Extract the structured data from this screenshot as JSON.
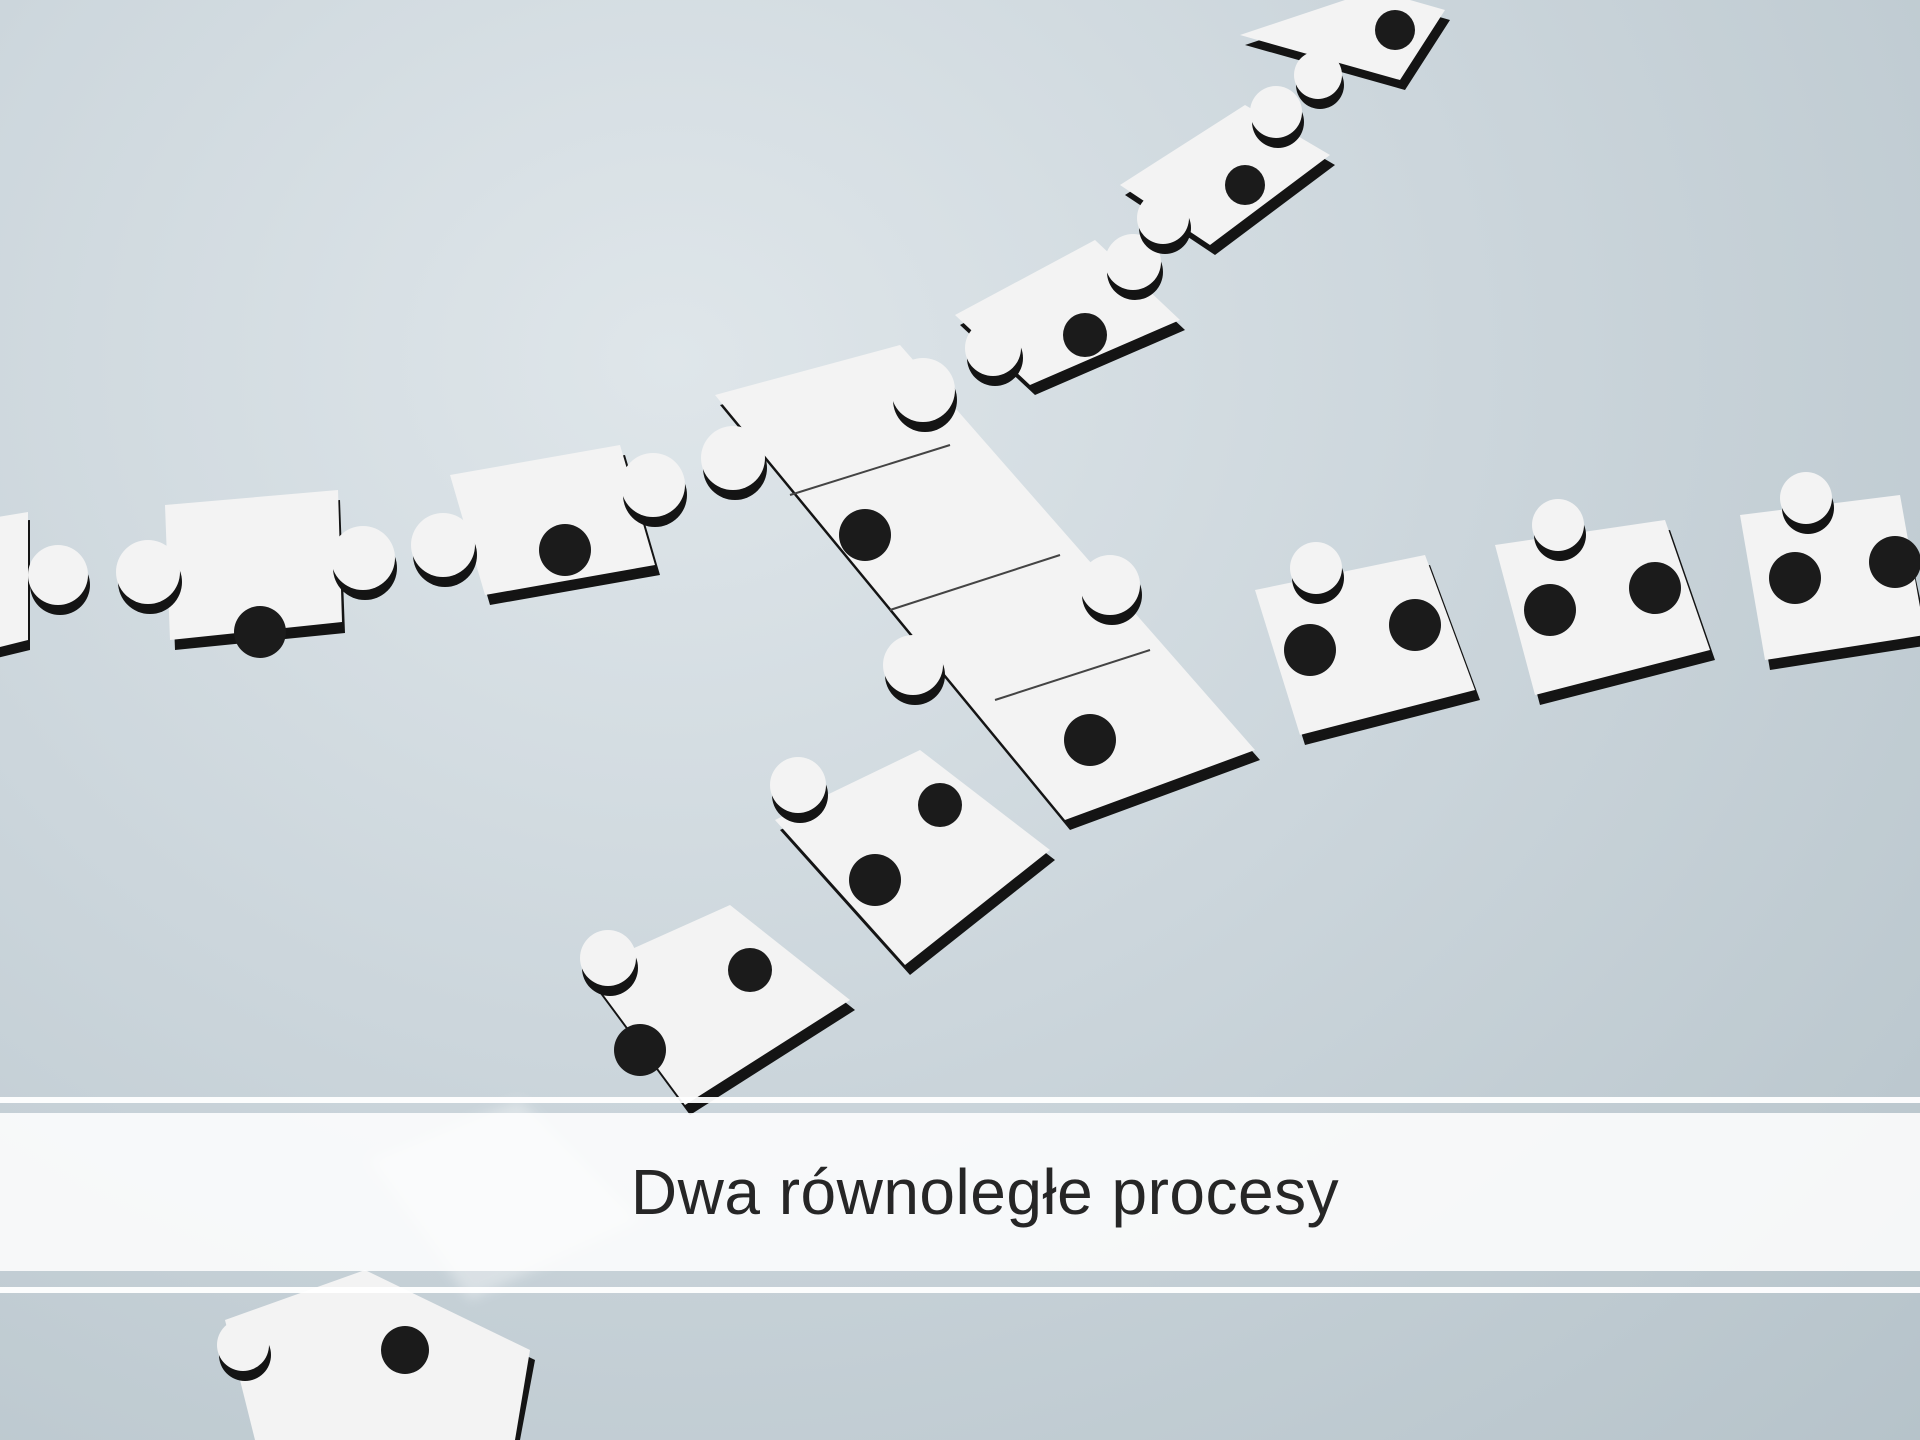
{
  "slide": {
    "title": "Dwa równoległe procesy"
  },
  "image": {
    "subject": "puzzle-pieces",
    "colors": {
      "background": "#ccd6dc",
      "piece_face": "#f4f4f4",
      "piece_edge": "#1b1b1b",
      "band": "#ffffff",
      "title_text": "#262626"
    }
  }
}
